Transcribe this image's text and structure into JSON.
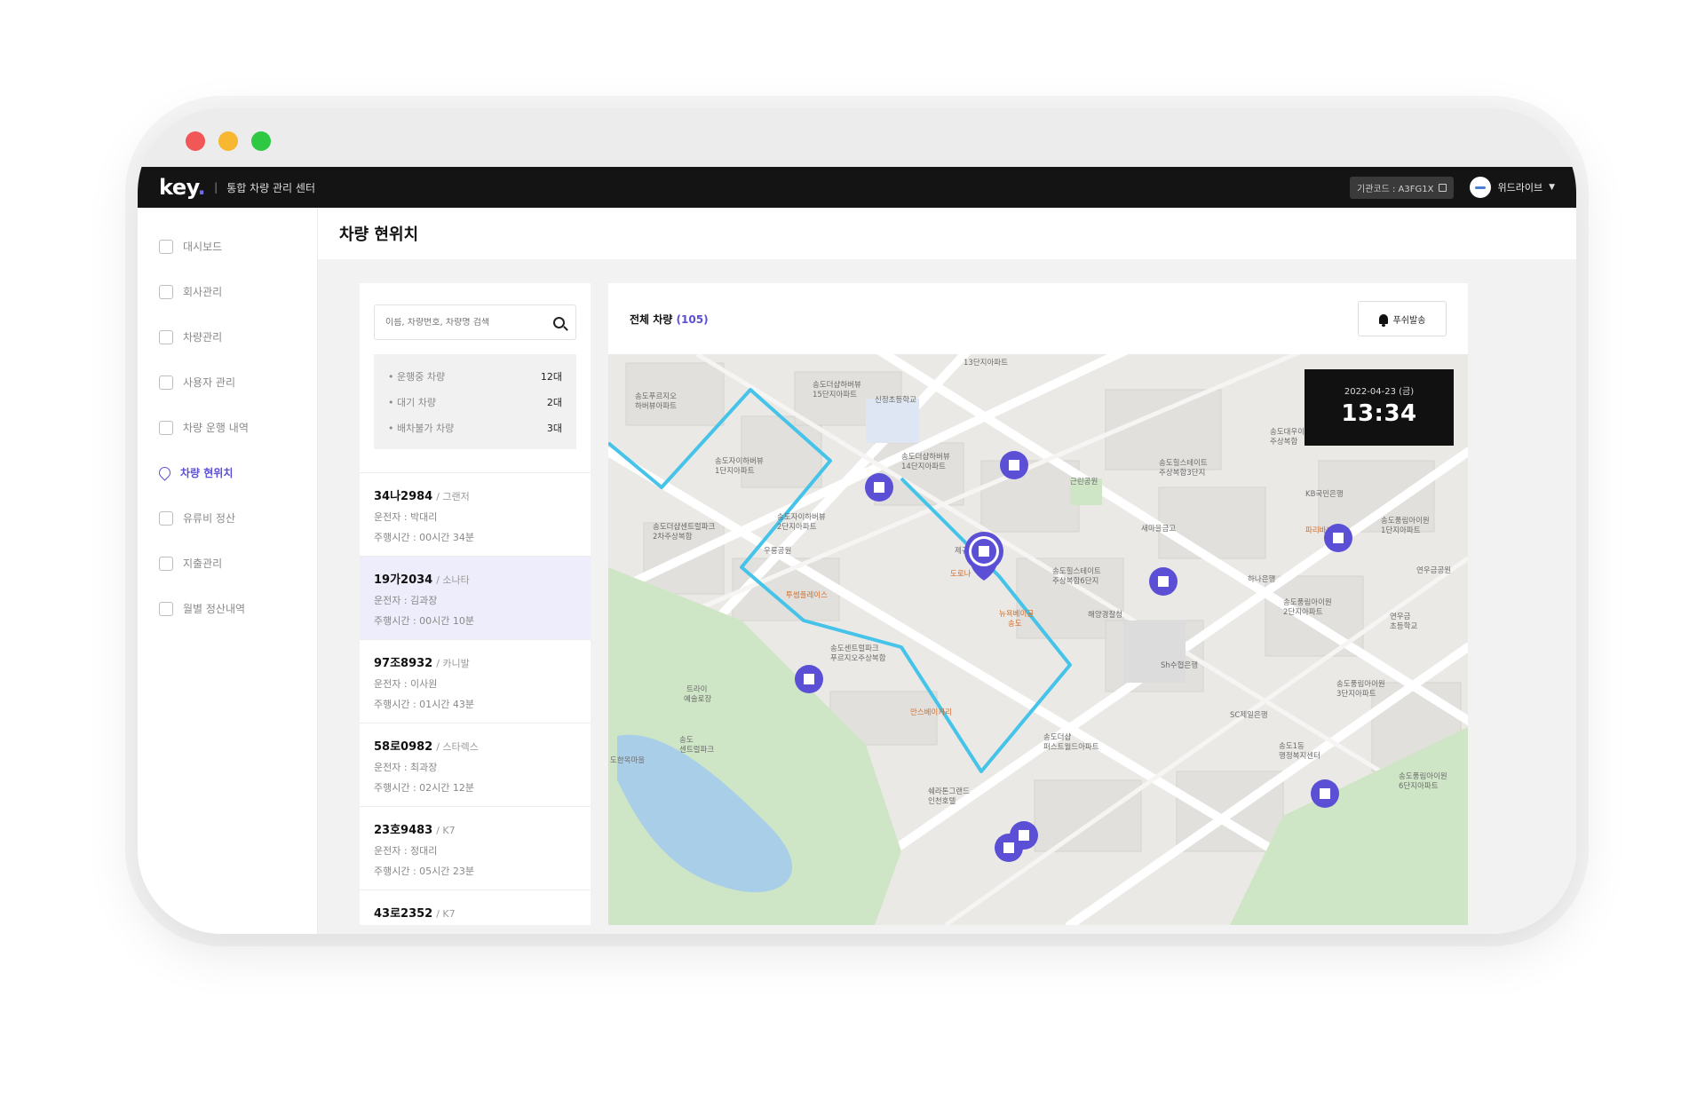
{
  "window": {
    "controls": [
      "close",
      "minimize",
      "maximize"
    ],
    "control_colors": [
      "#f25757",
      "#f7b731",
      "#2ec843"
    ]
  },
  "topbar": {
    "logo_text": "key",
    "logo_dot": ".",
    "separator": "|",
    "app_title": "통합 차량 관리 센터",
    "org_code": "기관코드 : A3FG1X",
    "user_name": "위드라이브",
    "accent": "#5b4fd6"
  },
  "sidebar": {
    "items": [
      {
        "label": "대시보드",
        "icon": "dashboard-icon"
      },
      {
        "label": "회사관리",
        "icon": "building-icon"
      },
      {
        "label": "차량관리",
        "icon": "car-icon"
      },
      {
        "label": "사용자 관리",
        "icon": "users-icon"
      },
      {
        "label": "차량 운행 내역",
        "icon": "clipboard-icon"
      },
      {
        "label": "차량 현위치",
        "icon": "location-pin-icon",
        "active": true
      },
      {
        "label": "유류비 정산",
        "icon": "fuel-icon"
      },
      {
        "label": "지출관리",
        "icon": "card-icon"
      },
      {
        "label": "월별 정산내역",
        "icon": "calendar-icon"
      }
    ]
  },
  "page": {
    "title": "차량 현위치"
  },
  "list": {
    "search_placeholder": "이름, 차량번호, 차량명 검색",
    "stats": [
      {
        "label": "• 운행중 차량",
        "value": "12대"
      },
      {
        "label": "• 대기 차량",
        "value": "2대"
      },
      {
        "label": "• 배차불가 차량",
        "value": "3대"
      }
    ],
    "vehicles": [
      {
        "plate": "34나2984",
        "model": "/ 그랜저",
        "driver": "운전자 : 박대리",
        "time": "주행시간 : 00시간 34분"
      },
      {
        "plate": "19가2034",
        "model": "/ 소나타",
        "driver": "운전자 : 김과장",
        "time": "주행시간 : 00시간 10분",
        "selected": true
      },
      {
        "plate": "97조8932",
        "model": "/ 카니발",
        "driver": "운전자 : 이사원",
        "time": "주행시간 : 01시간 43분"
      },
      {
        "plate": "58로0982",
        "model": "/ 스타렉스",
        "driver": "운전자 : 최과장",
        "time": "주행시간 : 02시간 12분"
      },
      {
        "plate": "23호9483",
        "model": "/ K7",
        "driver": "운전자 : 정대리",
        "time": "주행시간 : 05시간 23분"
      },
      {
        "plate": "43로2352",
        "model": "/ K7",
        "driver": "",
        "time": ""
      }
    ]
  },
  "map_panel": {
    "title": "전체 차량",
    "count_open": "(",
    "count": "105",
    "count_close": ")",
    "push_label": "푸쉬발송",
    "clock_date": "2022-04-23 (금)",
    "clock_time": "13:34",
    "route_color": "#45c3e8",
    "marker_color": "#5b4fd6",
    "labels": [
      "13단지아파트",
      "송도더샵하버뷰 15단지아파트",
      "신정초등학교",
      "송도푸르지오 하버뷰아파트",
      "송도더샵하버뷰 14단지아파트",
      "송도자이하버뷰 1단지아파트",
      "송도자이하버뷰 2단지아파트",
      "송도더샵센트럴파크 2차주상복합",
      "근린공원",
      "송도힐스테이트 주상복합3단지",
      "송도대우이안 주상복합",
      "KB국민은행",
      "파리바게트",
      "새마을금고",
      "제규어 드로버",
      "도로나",
      "송도힐스테이트 주상복합6단지",
      "하나은행",
      "송도풍림아이원 2단지아파트",
      "연우금공원",
      "송도풍림아이원 1단지아파트",
      "연우금 초등학교",
      "우룡공원",
      "투썸플레이스",
      "뉴욕베이글 송도",
      "해양경찰청",
      "Sh수협은행",
      "송도센트럴파크 푸르지오주상복합",
      "트라이 예술로장",
      "송도 센트럴파크",
      "안스베이커리",
      "SC제일은행",
      "송도풍림아이원 3단지아파트",
      "송도더샵 퍼스트월드아파트",
      "송도1동 행정복지센터",
      "송도풍림아이원 6단지아파트",
      "도한옥마을",
      "쉐라톤그랜드 인천호텔"
    ]
  }
}
